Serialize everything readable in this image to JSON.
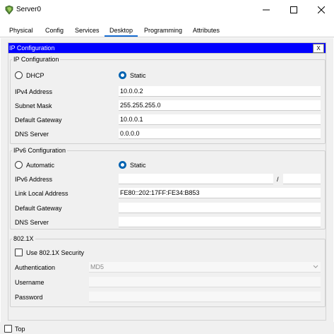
{
  "window": {
    "title": "Server0",
    "minimize_glyph": "—",
    "maximize_glyph": "☐",
    "close_glyph": "✕"
  },
  "tabs": [
    {
      "label": "Physical"
    },
    {
      "label": "Config"
    },
    {
      "label": "Services"
    },
    {
      "label": "Desktop"
    },
    {
      "label": "Programming"
    },
    {
      "label": "Attributes"
    }
  ],
  "ip_config": {
    "header_title": "IP Configuration",
    "close_label": "X",
    "ipv4": {
      "group_title": "IP Configuration",
      "dhcp_label": "DHCP",
      "static_label": "Static",
      "ipv4_address_label": "IPv4 Address",
      "ipv4_address": "10.0.0.2",
      "subnet_mask_label": "Subnet Mask",
      "subnet_mask": "255.255.255.0",
      "default_gateway_label": "Default Gateway",
      "default_gateway": "10.0.0.1",
      "dns_server_label": "DNS Server",
      "dns_server": "0.0.0.0"
    },
    "ipv6": {
      "group_title": "IPv6 Configuration",
      "automatic_label": "Automatic",
      "static_label": "Static",
      "ipv6_address_label": "IPv6 Address",
      "ipv6_address": "",
      "prefix_separator": "/",
      "prefix_length": "",
      "link_local_label": "Link Local Address",
      "link_local": "FE80::202:17FF:FE34:B853",
      "default_gateway_label": "Default Gateway",
      "default_gateway": "",
      "dns_server_label": "DNS Server",
      "dns_server": ""
    },
    "dot1x": {
      "group_title": "802.1X",
      "use_security_label": "Use 802.1X Security",
      "authentication_label": "Authentication",
      "authentication_value": "MD5",
      "username_label": "Username",
      "username": "",
      "password_label": "Password",
      "password": ""
    }
  },
  "footer": {
    "top_label": "Top"
  },
  "colors": {
    "header_blue": "#0000ff",
    "radio_selected": "#0063b1",
    "panel_bg": "#f0f0f0"
  }
}
